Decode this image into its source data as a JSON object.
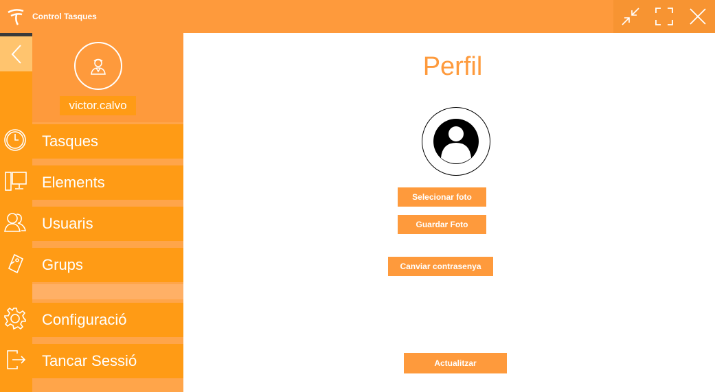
{
  "window": {
    "title": "Control Tasques",
    "controls": [
      "shrink-icon",
      "maximize-icon",
      "close-icon"
    ]
  },
  "colors": {
    "titlebar": "#fe9a3c",
    "nav_item": "#ff9b15",
    "accent": "#fe9a3c",
    "back_button": "#ffc46e"
  },
  "user": {
    "username": "victor.calvo"
  },
  "nav": {
    "items": [
      {
        "label": "Tasques",
        "icon": "clock-icon"
      },
      {
        "label": "Elements",
        "icon": "monitor-icon"
      },
      {
        "label": "Usuaris",
        "icon": "users-icon"
      },
      {
        "label": "Grups",
        "icon": "tag-icon"
      },
      {
        "label": "Configuració",
        "icon": "gear-icon"
      },
      {
        "label": "Tancar Sessió",
        "icon": "logout-icon"
      }
    ]
  },
  "main": {
    "title": "Perfil",
    "select_photo_label": "Selecionar foto",
    "save_photo_label": "Guardar Foto",
    "change_password_label": "Canviar contrasenya",
    "update_label": "Actualitzar"
  }
}
